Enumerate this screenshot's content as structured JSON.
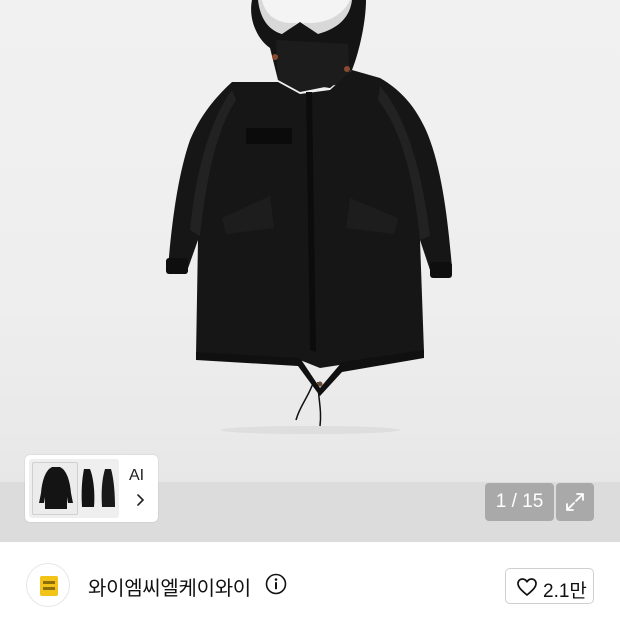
{
  "gallery": {
    "image_alt": "black hooded parka with fur-lined hood",
    "ai_label": "AI",
    "counter": "1 / 15",
    "expand_icon": "expand-arrows-icon",
    "chevron_icon": "chevron-right-icon"
  },
  "brand": {
    "name": "와이엠씨엘케이와이",
    "logo_icon": "brand-logo-icon",
    "info_icon": "info-circle-icon"
  },
  "like": {
    "icon": "heart-outline-icon",
    "count": "2.1만"
  },
  "colors": {
    "badge_bg": "#8a8a8a",
    "logo_accent": "#f2c318",
    "text": "#111111"
  }
}
